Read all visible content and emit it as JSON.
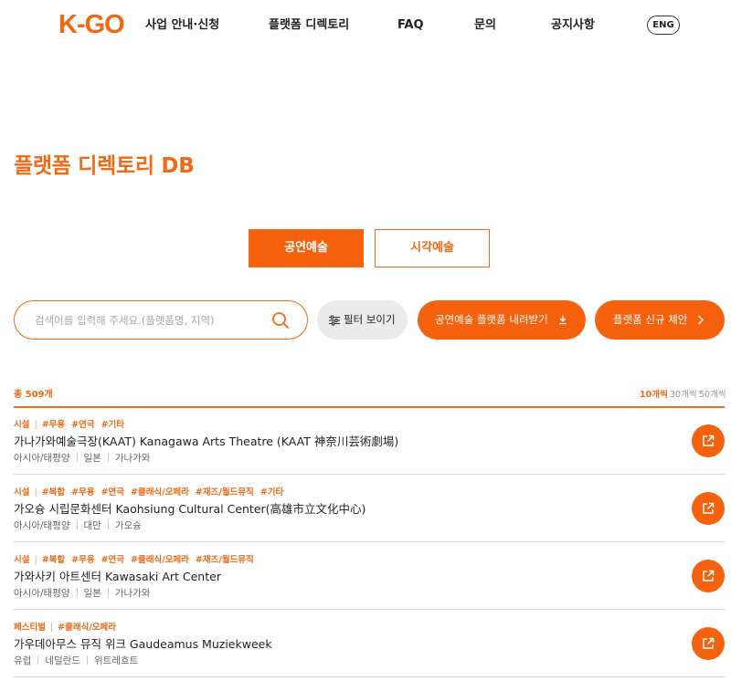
{
  "header": {
    "logo": "K-GO",
    "nav": [
      {
        "label": "사업 안내·신청"
      },
      {
        "label": "플랫폼 디렉토리"
      },
      {
        "label": "FAQ"
      },
      {
        "label": "문의"
      },
      {
        "label": "공지사항"
      }
    ],
    "lang": "ENG"
  },
  "page_title": "플랫폼 디렉토리 DB",
  "tabs": [
    {
      "label": "공연예술",
      "active": true
    },
    {
      "label": "시각예술",
      "active": false
    }
  ],
  "search": {
    "placeholder": "검색어를 입력해 주세요.(플랫폼명, 지역)",
    "value": ""
  },
  "filter_button": {
    "label": "필터 보이기"
  },
  "download_button": {
    "label": "공연예술 플랫폼 내려받기"
  },
  "propose_button": {
    "label": "플랫폼 신규 제안"
  },
  "total": "총 509개",
  "page_sizes": [
    {
      "label": "10개씩",
      "active": true
    },
    {
      "label": "30개씩",
      "active": false
    },
    {
      "label": "50개씩",
      "active": false
    }
  ],
  "items": [
    {
      "category": "시설",
      "tags": [
        "#무용",
        "#연극",
        "#기타"
      ],
      "title": "가나가와예술극장(KAAT) Kanagawa Arts Theatre (KAAT 神奈川芸術劇場)",
      "meta": [
        "아시아/태평양",
        "일본",
        "가나가와"
      ]
    },
    {
      "category": "시설",
      "tags": [
        "#복합",
        "#무용",
        "#연극",
        "#클래식/오페라",
        "#재즈/월드뮤직",
        "#기타"
      ],
      "title": "가오슝 시립문화센터 Kaohsiung Cultural Center(高雄市立文化中心)",
      "meta": [
        "아시아/태평양",
        "대만",
        "가오슝"
      ]
    },
    {
      "category": "시설",
      "tags": [
        "#복합",
        "#무용",
        "#연극",
        "#클래식/오페라",
        "#재즈/월드뮤직"
      ],
      "title": "가와사키 아트센터 Kawasaki Art Center",
      "meta": [
        "아시아/태평양",
        "일본",
        "가나가와"
      ]
    },
    {
      "category": "페스티벌",
      "tags": [
        "#클래식/오페라"
      ],
      "title": "가우데아무스 뮤직 위크 Gaudeamus Muziekweek",
      "meta": [
        "유럽",
        "네덜란드",
        "위트레흐트"
      ]
    }
  ],
  "colors": {
    "accent": "#f06a14",
    "button": "#f5610c",
    "filter_bg": "#ebebeb",
    "divider": "#d6d6d6"
  },
  "icons": {
    "search": "search-icon",
    "filter": "sliders-icon",
    "download": "download-icon",
    "chevron": "chevron-right-icon",
    "link": "external-link-icon"
  }
}
